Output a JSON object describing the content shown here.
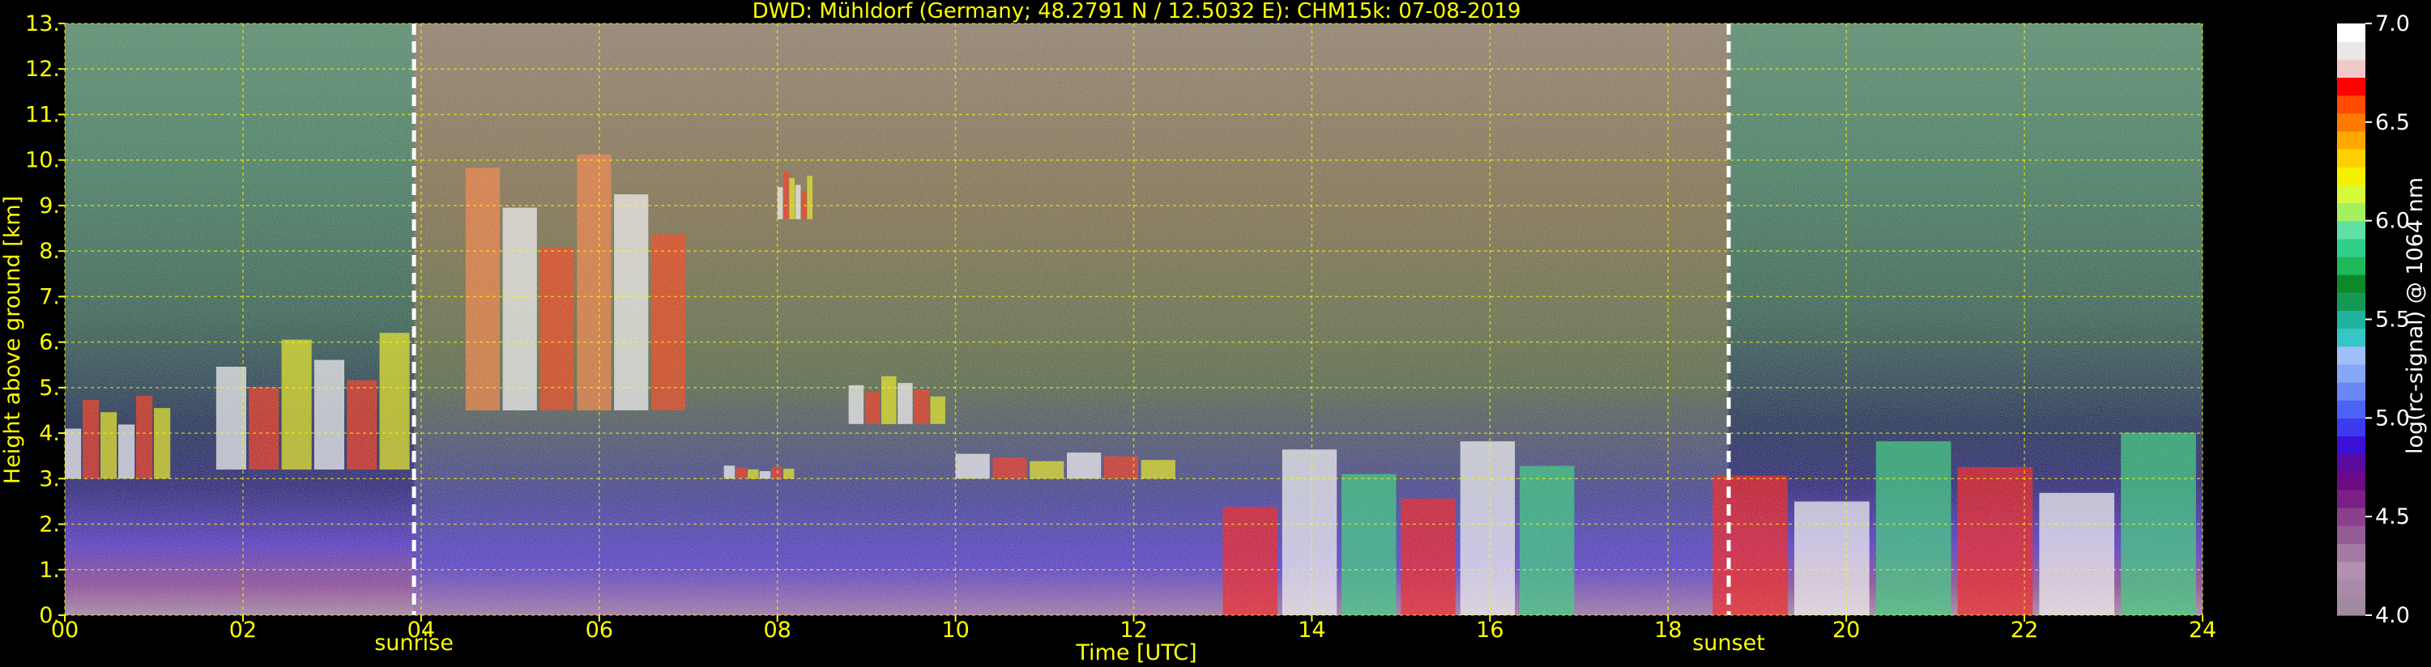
{
  "chart_data": {
    "type": "heatmap",
    "title": "DWD: Mühldorf (Germany; 48.2791 N / 12.5032 E):    CHM15k: 07-08-2019",
    "xlabel": "Time [UTC]",
    "ylabel": "Height above ground [km]",
    "xlim": [
      0,
      24
    ],
    "ylim": [
      0,
      13
    ],
    "x_ticks": [
      "00",
      "02",
      "04",
      "06",
      "08",
      "10",
      "12",
      "14",
      "16",
      "18",
      "20",
      "22",
      "24"
    ],
    "y_ticks": [
      "0.",
      "1.",
      "2.",
      "3.",
      "4.",
      "5.",
      "6.",
      "7.",
      "8.",
      "9.",
      "10.",
      "11.",
      "12.",
      "13."
    ],
    "grid": true,
    "colorbar": {
      "label": "log(rc-signal) @ 1064 nm",
      "range": [
        4.0,
        7.0
      ],
      "ticks": [
        "4.0",
        "4.5",
        "5.0",
        "5.5",
        "6.0",
        "6.5",
        "7.0"
      ],
      "colors": [
        "#a08aa0",
        "#a98ba9",
        "#b190b0",
        "#a27aa4",
        "#955c96",
        "#8a3f8f",
        "#7a1f85",
        "#6a0a85",
        "#5a0a9c",
        "#3c10d6",
        "#3b3cf0",
        "#4d63f5",
        "#6a86f7",
        "#86a6f8",
        "#a0bff8",
        "#36c6c6",
        "#1fb3a0",
        "#129a55",
        "#0c8a2a",
        "#1fb85a",
        "#2fd08a",
        "#5fe0a6",
        "#a6f060",
        "#d8f83a",
        "#f4f000",
        "#ffd000",
        "#ffa800",
        "#ff7a00",
        "#ff4a00",
        "#ff0000",
        "#f0c8c8",
        "#e8e8e8",
        "#ffffff"
      ]
    },
    "annotations": [
      {
        "label": "sunrise",
        "time": 3.92
      },
      {
        "label": "sunset",
        "time": 18.68
      }
    ],
    "features": [
      {
        "kind": "cloud_layer",
        "t0": 0.0,
        "t1": 1.2,
        "h0": 3.0,
        "h1": 5.0
      },
      {
        "kind": "cloud_layer",
        "t0": 1.7,
        "t1": 3.9,
        "h0": 3.2,
        "h1": 6.5
      },
      {
        "kind": "cirrus",
        "t0": 4.5,
        "t1": 7.0,
        "h0": 4.5,
        "h1": 11.0
      },
      {
        "kind": "cloud_layer",
        "t0": 7.4,
        "t1": 8.2,
        "h0": 3.0,
        "h1": 3.3
      },
      {
        "kind": "cloud_layer",
        "t0": 8.0,
        "t1": 8.4,
        "h0": 8.7,
        "h1": 9.8
      },
      {
        "kind": "cloud_layer",
        "t0": 8.8,
        "t1": 9.9,
        "h0": 4.2,
        "h1": 5.3
      },
      {
        "kind": "cloud_layer",
        "t0": 10.0,
        "t1": 12.5,
        "h0": 3.0,
        "h1": 3.6
      },
      {
        "kind": "convective",
        "t0": 13.0,
        "t1": 17.0,
        "h0": 0.0,
        "h1": 4.0
      },
      {
        "kind": "convective",
        "t0": 18.5,
        "t1": 24.0,
        "h0": 0.0,
        "h1": 4.2
      }
    ]
  }
}
